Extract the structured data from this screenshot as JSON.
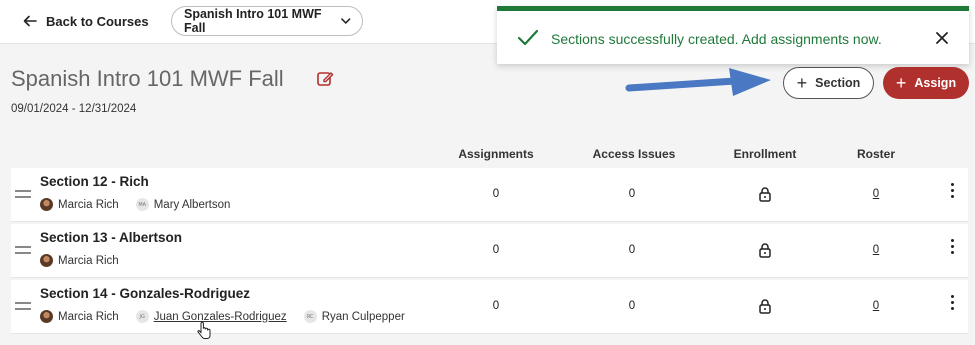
{
  "topbar": {
    "back_label": "Back to Courses",
    "course_select_value": "Spanish Intro 101 MWF Fall"
  },
  "toast": {
    "message": "Sections successfully created. Add assignments now.",
    "color": "#1f7a3a"
  },
  "course": {
    "title": "Spanish Intro 101 MWF Fall",
    "date_range": "09/01/2024 - 12/31/2024"
  },
  "actions": {
    "section_label": "Section",
    "assign_label": "Assign",
    "assign_color": "#b0302d"
  },
  "table": {
    "columns": [
      "Assignments",
      "Access Issues",
      "Enrollment",
      "Roster"
    ],
    "rows": [
      {
        "title": "Section 12 - Rich",
        "people": [
          {
            "initials": "",
            "name": "Marcia Rich",
            "linked": false
          },
          {
            "initials": "MA",
            "name": "Mary Albertson",
            "linked": false
          }
        ],
        "assignments": "0",
        "access_issues": "0",
        "roster": "0"
      },
      {
        "title": "Section 13 - Albertson",
        "people": [
          {
            "initials": "",
            "name": "Marcia Rich",
            "linked": false
          }
        ],
        "assignments": "0",
        "access_issues": "0",
        "roster": "0"
      },
      {
        "title": "Section 14 - Gonzales-Rodriguez",
        "people": [
          {
            "initials": "",
            "name": "Marcia Rich",
            "linked": false
          },
          {
            "initials": "JG",
            "name": "Juan Gonzales-Rodriguez",
            "linked": true
          },
          {
            "initials": "RC",
            "name": "Ryan Culpepper",
            "linked": false
          }
        ],
        "assignments": "0",
        "access_issues": "0",
        "roster": "0"
      }
    ]
  },
  "icons": {
    "back": "arrow-left-icon",
    "select": "chevron-down-icon",
    "toast_check": "checkmark-icon",
    "toast_close": "close-icon",
    "edit": "edit-icon",
    "enrollment": "lock-icon",
    "row_menu": "kebab-menu-icon",
    "drag": "drag-handle-icon"
  }
}
